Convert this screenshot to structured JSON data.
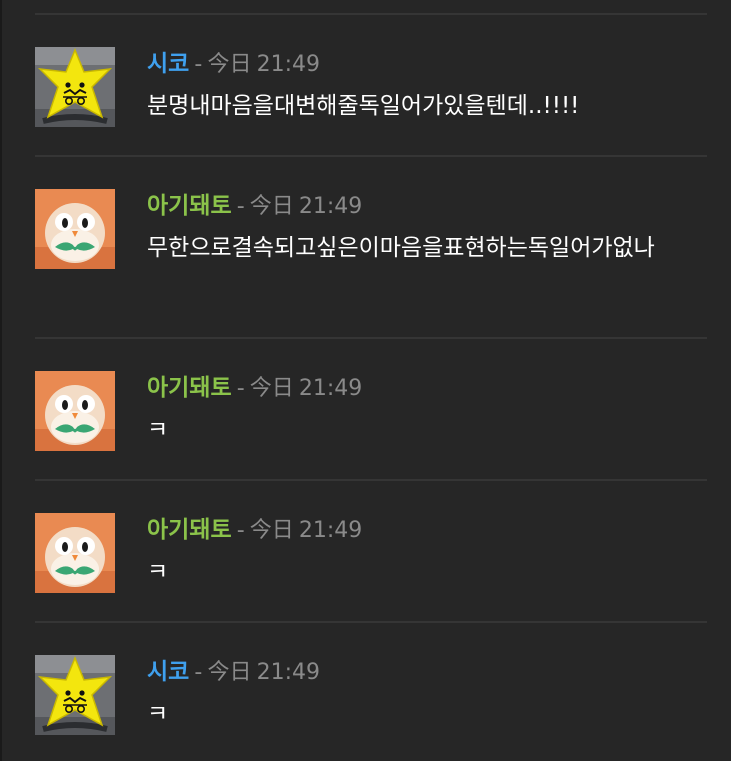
{
  "colors": {
    "background": "#262626",
    "divider": "#353535",
    "name_blue": "#3fa0ee",
    "name_green": "#8bc34a",
    "meta_gray": "#8a8a8a",
    "text": "#ffffff"
  },
  "messages": [
    {
      "author": "시코",
      "separator": "-",
      "date_label": "今日",
      "time": "21:49",
      "text": "분명내마음을대변해줄독일어가있을텐데..!!!!",
      "avatar_icon": "yellow-star-avatar"
    },
    {
      "author": "아기돼토",
      "separator": "-",
      "date_label": "今日",
      "time": "21:49",
      "text": "무한으로결속되고싶은이마음을표현하는독일어가없나",
      "avatar_icon": "owl-avatar"
    },
    {
      "author": "아기돼토",
      "separator": "-",
      "date_label": "今日",
      "time": "21:49",
      "text": "ㅋ",
      "avatar_icon": "owl-avatar"
    },
    {
      "author": "아기돼토",
      "separator": "-",
      "date_label": "今日",
      "time": "21:49",
      "text": "ㅋ",
      "avatar_icon": "owl-avatar"
    },
    {
      "author": "시코",
      "separator": "-",
      "date_label": "今日",
      "time": "21:49",
      "text": "ㅋ",
      "avatar_icon": "yellow-star-avatar"
    }
  ]
}
